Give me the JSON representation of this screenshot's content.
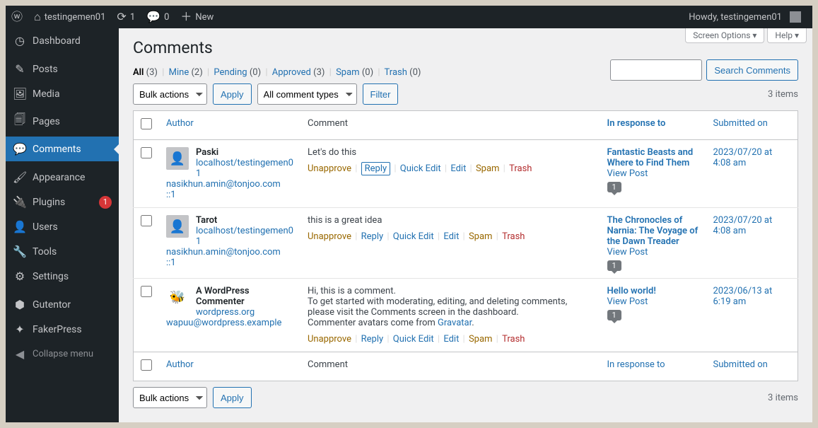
{
  "adminbar": {
    "site_name": "testingemen01",
    "updates": "1",
    "comments_count": "0",
    "new_label": "New",
    "howdy": "Howdy, testingemen01"
  },
  "sidebar": {
    "items": [
      {
        "label": "Dashboard",
        "icon": "◷"
      },
      {
        "label": "Posts",
        "icon": "✎"
      },
      {
        "label": "Media",
        "icon": "🖼"
      },
      {
        "label": "Pages",
        "icon": "🗐"
      },
      {
        "label": "Comments",
        "icon": "💬",
        "current": true
      },
      {
        "label": "Appearance",
        "icon": "🖌"
      },
      {
        "label": "Plugins",
        "icon": "🔌",
        "badge": "1"
      },
      {
        "label": "Users",
        "icon": "👤"
      },
      {
        "label": "Tools",
        "icon": "🔧"
      },
      {
        "label": "Settings",
        "icon": "⚙"
      },
      {
        "label": "Gutentor",
        "icon": "⬢"
      },
      {
        "label": "FakerPress",
        "icon": "✦"
      }
    ],
    "collapse": "Collapse menu"
  },
  "top_tabs": {
    "screen_options": "Screen Options",
    "help": "Help"
  },
  "page": {
    "title": "Comments",
    "filters": {
      "all": {
        "label": "All",
        "count": "(3)"
      },
      "mine": {
        "label": "Mine",
        "count": "(2)"
      },
      "pending": {
        "label": "Pending",
        "count": "(0)"
      },
      "approved": {
        "label": "Approved",
        "count": "(3)"
      },
      "spam": {
        "label": "Spam",
        "count": "(0)"
      },
      "trash": {
        "label": "Trash",
        "count": "(0)"
      }
    },
    "bulk_actions": "Bulk actions",
    "apply": "Apply",
    "comment_types": "All comment types",
    "filter_btn": "Filter",
    "search_btn": "Search Comments",
    "items_count": "3 items"
  },
  "columns": {
    "author": "Author",
    "comment": "Comment",
    "response": "In response to",
    "date": "Submitted on"
  },
  "row_actions": {
    "unapprove": "Unapprove",
    "reply": "Reply",
    "quick_edit": "Quick Edit",
    "edit": "Edit",
    "spam": "Spam",
    "trash": "Trash"
  },
  "gravatar_link": "Gravatar",
  "comments": [
    {
      "author": "Paski",
      "url": "localhost/testingemen01",
      "email": "nasikhun.amin@tonjoo.com",
      "ip": "::1",
      "text": "Let's do this",
      "reply_boxed": true,
      "post": "Fantastic Beasts and Where to Find Them",
      "viewpost": "View Post",
      "bubble": "1",
      "date": "2023/07/20 at 4:08 am"
    },
    {
      "author": "Tarot",
      "url": "localhost/testingemen01",
      "email": "nasikhun.amin@tonjoo.com",
      "ip": "::1",
      "text": "this is a great idea",
      "reply_boxed": false,
      "post": "The Chronocles of Narnia: The Voyage of the Dawn Treader",
      "viewpost": "View Post",
      "bubble": "1",
      "date": "2023/07/20 at 4:08 am"
    },
    {
      "author": "A WordPress Commenter",
      "url": "wordpress.org",
      "email": "wapuu@wordpress.example",
      "ip": "",
      "text_lines": [
        "Hi, this is a comment.",
        "To get started with moderating, editing, and deleting comments, please visit the Comments screen in the dashboard.",
        "Commenter avatars come from "
      ],
      "reply_boxed": false,
      "post": "Hello world!",
      "viewpost": "View Post",
      "bubble": "1",
      "date": "2023/06/13 at 6:19 am",
      "wapuu": true
    }
  ]
}
